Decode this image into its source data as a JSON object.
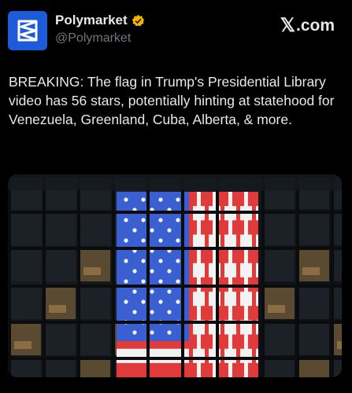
{
  "account": {
    "display_name": "Polymarket",
    "handle": "@Polymarket",
    "verified_icon": "verified-badge-icon",
    "avatar_icon": "polymarket-logo-icon",
    "avatar_color": "#1d5bd8"
  },
  "source": {
    "label": ".com",
    "icon": "x-logo-icon"
  },
  "post": {
    "text": "BREAKING: The flag in Trump's Presidential Library video has 56 stars, potentially hinting at statehood for Venezuela, Greenland, Cuba, Alberta, & more."
  },
  "media": {
    "alt": "photo-building-with-american-flag",
    "colors": {
      "flag_blue": "#3a5fd0",
      "flag_red": "#e03a3a",
      "flag_white": "#f2f2f2"
    }
  }
}
